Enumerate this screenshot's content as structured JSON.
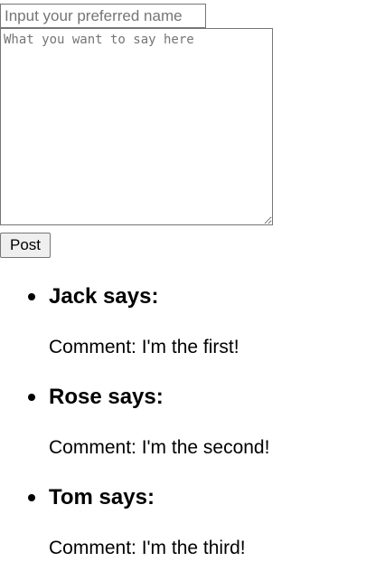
{
  "form": {
    "name_placeholder": "Input your preferred name",
    "message_placeholder": "What you want to say here",
    "post_label": "Post"
  },
  "comments": [
    {
      "author": "Jack says:",
      "text": "Comment: I'm the first!"
    },
    {
      "author": "Rose says:",
      "text": "Comment: I'm the second!"
    },
    {
      "author": "Tom says:",
      "text": "Comment: I'm the third!"
    }
  ]
}
